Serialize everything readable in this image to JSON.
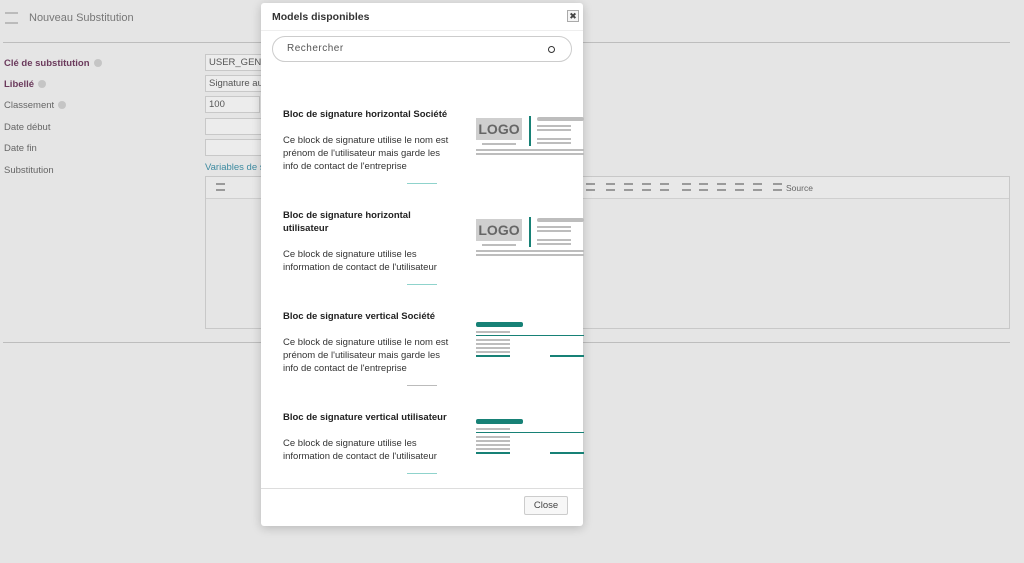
{
  "header": {
    "title": "Nouveau Substitution",
    "icon": "substitution-icon"
  },
  "form": {
    "key_label": "Clé de substitution",
    "key_value": "USER_GEN",
    "label_label": "Libellé",
    "label_value": "Signature au",
    "rank_label": "Classement",
    "rank_value": "100",
    "start_label": "Date début",
    "end_label": "Date fin",
    "subst_label": "Substitution",
    "vars_link": "Variables de s",
    "source_label": "Source"
  },
  "modal": {
    "title": "Models disponibles",
    "search_placeholder": "Rechercher",
    "close_label": "Close",
    "items": [
      {
        "title": "Bloc de signature horizontal Société",
        "desc": "Ce block de signature utilise le nom est prénom de l'utilisateur mais garde les info de contact de l'entreprise",
        "logo": "LOGO"
      },
      {
        "title": "Bloc de signature horizontal utilisateur",
        "desc": "Ce block de signature utilise les information de contact de l'utilisateur",
        "logo": "LOGO"
      },
      {
        "title": "Bloc de signature vertical Société",
        "desc": "Ce block de signature utilise le nom est prénom de l'utilisateur mais garde les info de contact de l'entreprise"
      },
      {
        "title": "Bloc de signature vertical utilisateur",
        "desc": "Ce block de signature utilise les information de contact de l'utilisateur"
      }
    ]
  },
  "colors": {
    "accent": "#178176",
    "label": "#6b3a5c"
  }
}
